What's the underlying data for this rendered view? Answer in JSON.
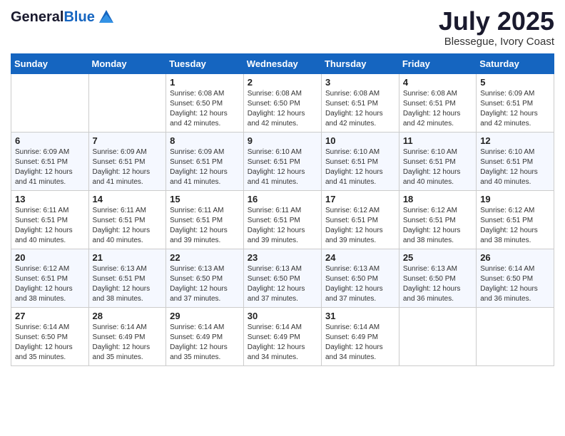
{
  "header": {
    "logo_general": "General",
    "logo_blue": "Blue",
    "month_title": "July 2025",
    "location": "Blessegue, Ivory Coast"
  },
  "days_of_week": [
    "Sunday",
    "Monday",
    "Tuesday",
    "Wednesday",
    "Thursday",
    "Friday",
    "Saturday"
  ],
  "weeks": [
    [
      {
        "day": "",
        "info": ""
      },
      {
        "day": "",
        "info": ""
      },
      {
        "day": "1",
        "info": "Sunrise: 6:08 AM\nSunset: 6:50 PM\nDaylight: 12 hours and 42 minutes."
      },
      {
        "day": "2",
        "info": "Sunrise: 6:08 AM\nSunset: 6:50 PM\nDaylight: 12 hours and 42 minutes."
      },
      {
        "day": "3",
        "info": "Sunrise: 6:08 AM\nSunset: 6:51 PM\nDaylight: 12 hours and 42 minutes."
      },
      {
        "day": "4",
        "info": "Sunrise: 6:08 AM\nSunset: 6:51 PM\nDaylight: 12 hours and 42 minutes."
      },
      {
        "day": "5",
        "info": "Sunrise: 6:09 AM\nSunset: 6:51 PM\nDaylight: 12 hours and 42 minutes."
      }
    ],
    [
      {
        "day": "6",
        "info": "Sunrise: 6:09 AM\nSunset: 6:51 PM\nDaylight: 12 hours and 41 minutes."
      },
      {
        "day": "7",
        "info": "Sunrise: 6:09 AM\nSunset: 6:51 PM\nDaylight: 12 hours and 41 minutes."
      },
      {
        "day": "8",
        "info": "Sunrise: 6:09 AM\nSunset: 6:51 PM\nDaylight: 12 hours and 41 minutes."
      },
      {
        "day": "9",
        "info": "Sunrise: 6:10 AM\nSunset: 6:51 PM\nDaylight: 12 hours and 41 minutes."
      },
      {
        "day": "10",
        "info": "Sunrise: 6:10 AM\nSunset: 6:51 PM\nDaylight: 12 hours and 41 minutes."
      },
      {
        "day": "11",
        "info": "Sunrise: 6:10 AM\nSunset: 6:51 PM\nDaylight: 12 hours and 40 minutes."
      },
      {
        "day": "12",
        "info": "Sunrise: 6:10 AM\nSunset: 6:51 PM\nDaylight: 12 hours and 40 minutes."
      }
    ],
    [
      {
        "day": "13",
        "info": "Sunrise: 6:11 AM\nSunset: 6:51 PM\nDaylight: 12 hours and 40 minutes."
      },
      {
        "day": "14",
        "info": "Sunrise: 6:11 AM\nSunset: 6:51 PM\nDaylight: 12 hours and 40 minutes."
      },
      {
        "day": "15",
        "info": "Sunrise: 6:11 AM\nSunset: 6:51 PM\nDaylight: 12 hours and 39 minutes."
      },
      {
        "day": "16",
        "info": "Sunrise: 6:11 AM\nSunset: 6:51 PM\nDaylight: 12 hours and 39 minutes."
      },
      {
        "day": "17",
        "info": "Sunrise: 6:12 AM\nSunset: 6:51 PM\nDaylight: 12 hours and 39 minutes."
      },
      {
        "day": "18",
        "info": "Sunrise: 6:12 AM\nSunset: 6:51 PM\nDaylight: 12 hours and 38 minutes."
      },
      {
        "day": "19",
        "info": "Sunrise: 6:12 AM\nSunset: 6:51 PM\nDaylight: 12 hours and 38 minutes."
      }
    ],
    [
      {
        "day": "20",
        "info": "Sunrise: 6:12 AM\nSunset: 6:51 PM\nDaylight: 12 hours and 38 minutes."
      },
      {
        "day": "21",
        "info": "Sunrise: 6:13 AM\nSunset: 6:51 PM\nDaylight: 12 hours and 38 minutes."
      },
      {
        "day": "22",
        "info": "Sunrise: 6:13 AM\nSunset: 6:50 PM\nDaylight: 12 hours and 37 minutes."
      },
      {
        "day": "23",
        "info": "Sunrise: 6:13 AM\nSunset: 6:50 PM\nDaylight: 12 hours and 37 minutes."
      },
      {
        "day": "24",
        "info": "Sunrise: 6:13 AM\nSunset: 6:50 PM\nDaylight: 12 hours and 37 minutes."
      },
      {
        "day": "25",
        "info": "Sunrise: 6:13 AM\nSunset: 6:50 PM\nDaylight: 12 hours and 36 minutes."
      },
      {
        "day": "26",
        "info": "Sunrise: 6:14 AM\nSunset: 6:50 PM\nDaylight: 12 hours and 36 minutes."
      }
    ],
    [
      {
        "day": "27",
        "info": "Sunrise: 6:14 AM\nSunset: 6:50 PM\nDaylight: 12 hours and 35 minutes."
      },
      {
        "day": "28",
        "info": "Sunrise: 6:14 AM\nSunset: 6:49 PM\nDaylight: 12 hours and 35 minutes."
      },
      {
        "day": "29",
        "info": "Sunrise: 6:14 AM\nSunset: 6:49 PM\nDaylight: 12 hours and 35 minutes."
      },
      {
        "day": "30",
        "info": "Sunrise: 6:14 AM\nSunset: 6:49 PM\nDaylight: 12 hours and 34 minutes."
      },
      {
        "day": "31",
        "info": "Sunrise: 6:14 AM\nSunset: 6:49 PM\nDaylight: 12 hours and 34 minutes."
      },
      {
        "day": "",
        "info": ""
      },
      {
        "day": "",
        "info": ""
      }
    ]
  ]
}
